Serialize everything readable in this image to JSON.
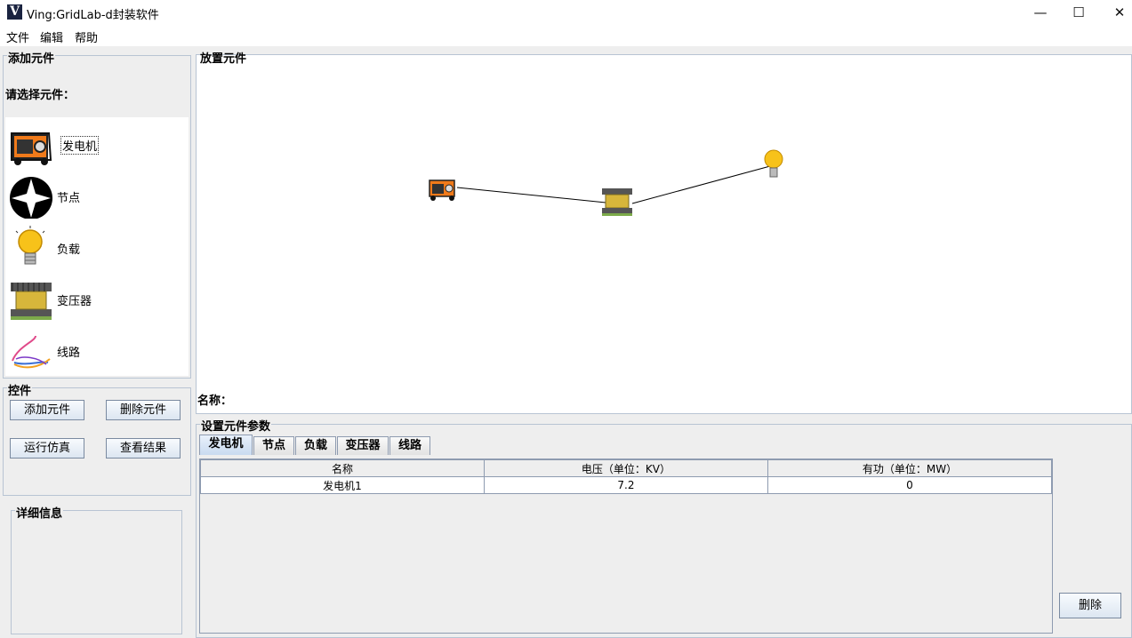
{
  "window": {
    "title": "Ving:GridLab-d封装软件",
    "icon_letter": "V"
  },
  "menu": [
    "文件",
    "编辑",
    "帮助"
  ],
  "left_panel": {
    "add_group_title": "添加元件",
    "prompt": "请选择元件：",
    "components": [
      {
        "label": "发电机",
        "icon": "generator-icon"
      },
      {
        "label": "节点",
        "icon": "node-star-icon"
      },
      {
        "label": "负载",
        "icon": "lightbulb-icon"
      },
      {
        "label": "变压器",
        "icon": "transformer-icon"
      },
      {
        "label": "线路",
        "icon": "line-cable-icon"
      }
    ],
    "controls_title": "控件",
    "buttons": {
      "add": "添加元件",
      "delete": "删除元件",
      "run": "运行仿真",
      "view": "查看结果"
    },
    "details_title": "详细信息"
  },
  "canvas": {
    "title": "放置元件",
    "name_label": "名称："
  },
  "params": {
    "title": "设置元件参数",
    "tabs": [
      "发电机",
      "节点",
      "负载",
      "变压器",
      "线路"
    ],
    "active_tab": 0,
    "columns": [
      "名称",
      "电压（单位：KV）",
      "有功（单位：MW）"
    ],
    "rows": [
      [
        "发电机1",
        "7.2",
        "0"
      ]
    ],
    "delete_button": "删除"
  }
}
